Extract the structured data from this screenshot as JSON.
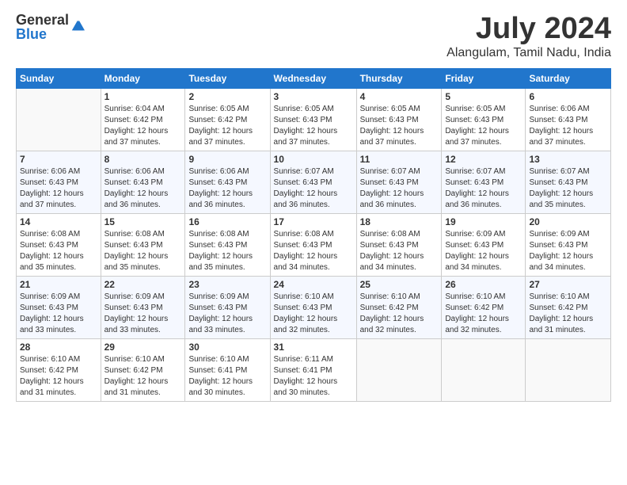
{
  "logo": {
    "general": "General",
    "blue": "Blue"
  },
  "header": {
    "month_year": "July 2024",
    "location": "Alangulam, Tamil Nadu, India"
  },
  "weekdays": [
    "Sunday",
    "Monday",
    "Tuesday",
    "Wednesday",
    "Thursday",
    "Friday",
    "Saturday"
  ],
  "weeks": [
    [
      {
        "day": "",
        "info": ""
      },
      {
        "day": "1",
        "info": "Sunrise: 6:04 AM\nSunset: 6:42 PM\nDaylight: 12 hours\nand 37 minutes."
      },
      {
        "day": "2",
        "info": "Sunrise: 6:05 AM\nSunset: 6:42 PM\nDaylight: 12 hours\nand 37 minutes."
      },
      {
        "day": "3",
        "info": "Sunrise: 6:05 AM\nSunset: 6:43 PM\nDaylight: 12 hours\nand 37 minutes."
      },
      {
        "day": "4",
        "info": "Sunrise: 6:05 AM\nSunset: 6:43 PM\nDaylight: 12 hours\nand 37 minutes."
      },
      {
        "day": "5",
        "info": "Sunrise: 6:05 AM\nSunset: 6:43 PM\nDaylight: 12 hours\nand 37 minutes."
      },
      {
        "day": "6",
        "info": "Sunrise: 6:06 AM\nSunset: 6:43 PM\nDaylight: 12 hours\nand 37 minutes."
      }
    ],
    [
      {
        "day": "7",
        "info": "Sunrise: 6:06 AM\nSunset: 6:43 PM\nDaylight: 12 hours\nand 37 minutes."
      },
      {
        "day": "8",
        "info": "Sunrise: 6:06 AM\nSunset: 6:43 PM\nDaylight: 12 hours\nand 36 minutes."
      },
      {
        "day": "9",
        "info": "Sunrise: 6:06 AM\nSunset: 6:43 PM\nDaylight: 12 hours\nand 36 minutes."
      },
      {
        "day": "10",
        "info": "Sunrise: 6:07 AM\nSunset: 6:43 PM\nDaylight: 12 hours\nand 36 minutes."
      },
      {
        "day": "11",
        "info": "Sunrise: 6:07 AM\nSunset: 6:43 PM\nDaylight: 12 hours\nand 36 minutes."
      },
      {
        "day": "12",
        "info": "Sunrise: 6:07 AM\nSunset: 6:43 PM\nDaylight: 12 hours\nand 36 minutes."
      },
      {
        "day": "13",
        "info": "Sunrise: 6:07 AM\nSunset: 6:43 PM\nDaylight: 12 hours\nand 35 minutes."
      }
    ],
    [
      {
        "day": "14",
        "info": "Sunrise: 6:08 AM\nSunset: 6:43 PM\nDaylight: 12 hours\nand 35 minutes."
      },
      {
        "day": "15",
        "info": "Sunrise: 6:08 AM\nSunset: 6:43 PM\nDaylight: 12 hours\nand 35 minutes."
      },
      {
        "day": "16",
        "info": "Sunrise: 6:08 AM\nSunset: 6:43 PM\nDaylight: 12 hours\nand 35 minutes."
      },
      {
        "day": "17",
        "info": "Sunrise: 6:08 AM\nSunset: 6:43 PM\nDaylight: 12 hours\nand 34 minutes."
      },
      {
        "day": "18",
        "info": "Sunrise: 6:08 AM\nSunset: 6:43 PM\nDaylight: 12 hours\nand 34 minutes."
      },
      {
        "day": "19",
        "info": "Sunrise: 6:09 AM\nSunset: 6:43 PM\nDaylight: 12 hours\nand 34 minutes."
      },
      {
        "day": "20",
        "info": "Sunrise: 6:09 AM\nSunset: 6:43 PM\nDaylight: 12 hours\nand 34 minutes."
      }
    ],
    [
      {
        "day": "21",
        "info": "Sunrise: 6:09 AM\nSunset: 6:43 PM\nDaylight: 12 hours\nand 33 minutes."
      },
      {
        "day": "22",
        "info": "Sunrise: 6:09 AM\nSunset: 6:43 PM\nDaylight: 12 hours\nand 33 minutes."
      },
      {
        "day": "23",
        "info": "Sunrise: 6:09 AM\nSunset: 6:43 PM\nDaylight: 12 hours\nand 33 minutes."
      },
      {
        "day": "24",
        "info": "Sunrise: 6:10 AM\nSunset: 6:43 PM\nDaylight: 12 hours\nand 32 minutes."
      },
      {
        "day": "25",
        "info": "Sunrise: 6:10 AM\nSunset: 6:42 PM\nDaylight: 12 hours\nand 32 minutes."
      },
      {
        "day": "26",
        "info": "Sunrise: 6:10 AM\nSunset: 6:42 PM\nDaylight: 12 hours\nand 32 minutes."
      },
      {
        "day": "27",
        "info": "Sunrise: 6:10 AM\nSunset: 6:42 PM\nDaylight: 12 hours\nand 31 minutes."
      }
    ],
    [
      {
        "day": "28",
        "info": "Sunrise: 6:10 AM\nSunset: 6:42 PM\nDaylight: 12 hours\nand 31 minutes."
      },
      {
        "day": "29",
        "info": "Sunrise: 6:10 AM\nSunset: 6:42 PM\nDaylight: 12 hours\nand 31 minutes."
      },
      {
        "day": "30",
        "info": "Sunrise: 6:10 AM\nSunset: 6:41 PM\nDaylight: 12 hours\nand 30 minutes."
      },
      {
        "day": "31",
        "info": "Sunrise: 6:11 AM\nSunset: 6:41 PM\nDaylight: 12 hours\nand 30 minutes."
      },
      {
        "day": "",
        "info": ""
      },
      {
        "day": "",
        "info": ""
      },
      {
        "day": "",
        "info": ""
      }
    ]
  ]
}
